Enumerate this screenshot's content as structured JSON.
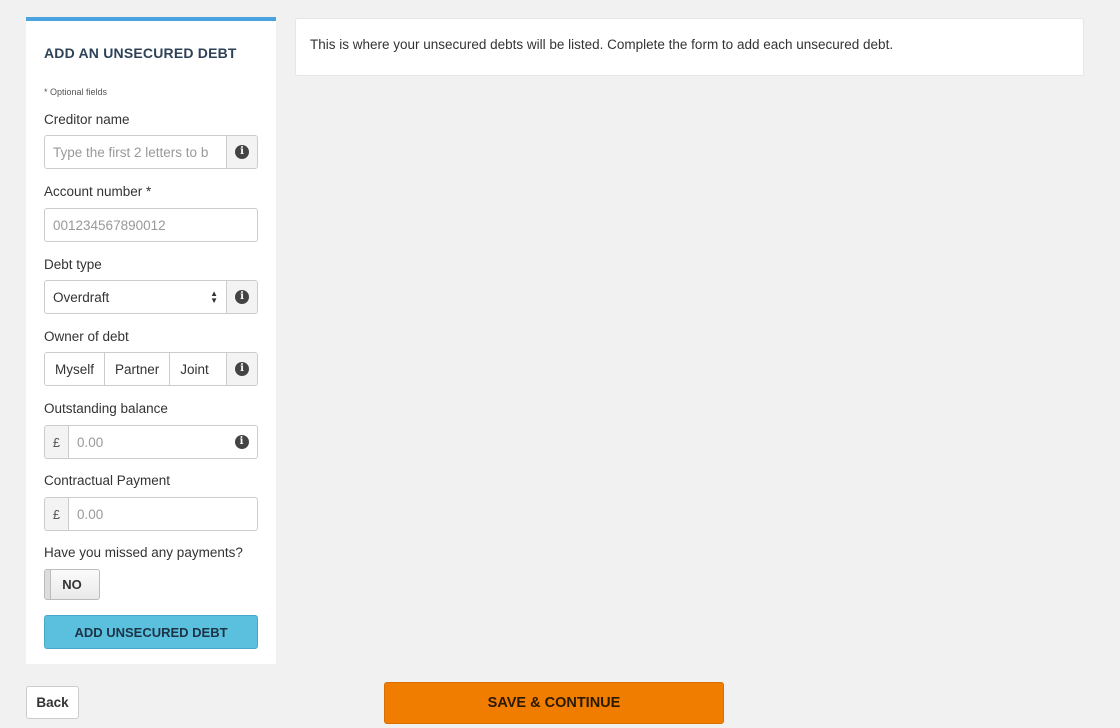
{
  "panel": {
    "title": "ADD AN UNSECURED DEBT",
    "optional_note": "* Optional fields"
  },
  "form": {
    "creditor_name": {
      "label": "Creditor name",
      "placeholder": "Type the first 2 letters to b"
    },
    "account_number": {
      "label": "Account number *",
      "placeholder": "001234567890012"
    },
    "debt_type": {
      "label": "Debt type",
      "value": "Overdraft"
    },
    "owner": {
      "label": "Owner of debt",
      "options": [
        "Myself",
        "Partner",
        "Joint"
      ]
    },
    "outstanding_balance": {
      "label": "Outstanding balance",
      "currency": "£",
      "placeholder": "0.00"
    },
    "contractual_payment": {
      "label": "Contractual Payment",
      "currency": "£",
      "placeholder": "0.00"
    },
    "missed_payments": {
      "label": "Have you missed any payments?",
      "value": "NO"
    },
    "submit_label": "ADD UNSECURED DEBT"
  },
  "info": {
    "message": "This is where your unsecured debts will be listed. Complete the form to add each unsecured debt."
  },
  "footer": {
    "back_label": "Back",
    "save_label": "SAVE & CONTINUE"
  },
  "colors": {
    "panel_accent": "#4aa3df",
    "add_button": "#5bc0de",
    "save_button": "#f07c00",
    "background": "#f1f1f1"
  },
  "icons": {
    "info": "info-circle-icon",
    "select_arrows": "sort-arrows-icon"
  }
}
